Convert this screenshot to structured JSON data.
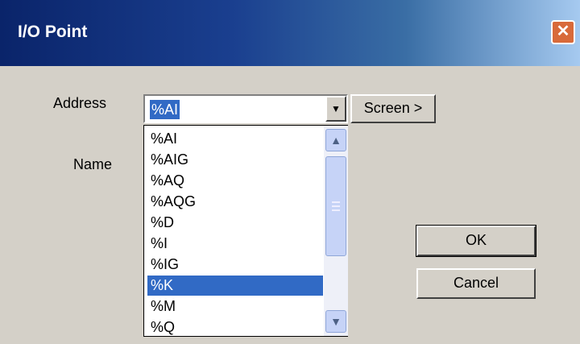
{
  "window": {
    "title": "I/O Point",
    "close_glyph": "✕"
  },
  "labels": {
    "address": "Address",
    "name": "Name"
  },
  "address_combo": {
    "selected": "%AI",
    "arrow_glyph": "▼",
    "options": [
      "%AI",
      "%AIG",
      "%AQ",
      "%AQG",
      "%D",
      "%I",
      "%IG",
      "%K",
      "%M",
      "%Q"
    ],
    "highlighted": "%K"
  },
  "buttons": {
    "screen": "Screen >",
    "ok": "OK",
    "cancel": "Cancel"
  },
  "scrollbar": {
    "up_glyph": "▲",
    "down_glyph": "▼"
  },
  "colors": {
    "title_bar": "#0a246a",
    "selection": "#316ac5",
    "face": "#d4d0c8"
  }
}
